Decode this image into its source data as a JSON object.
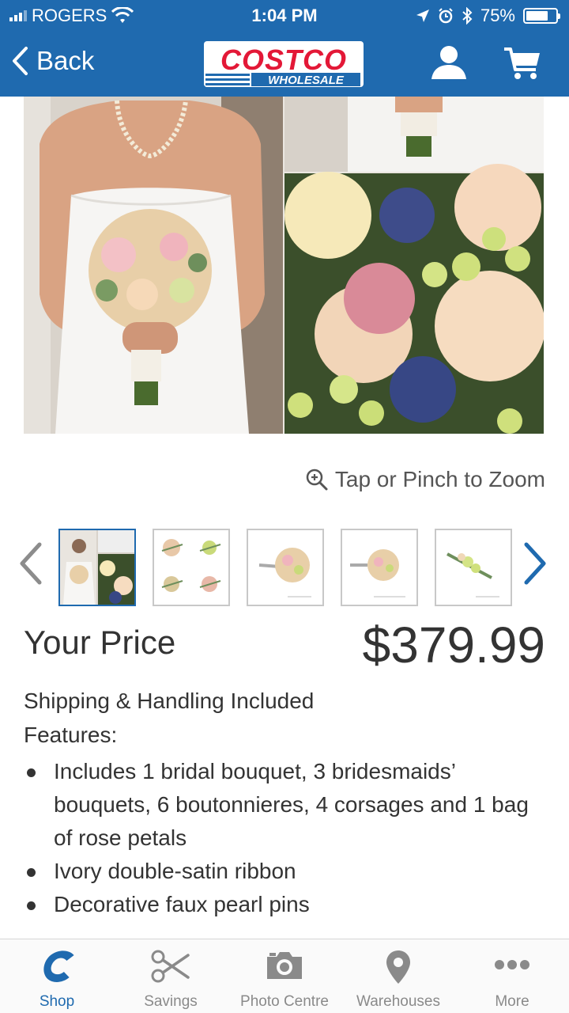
{
  "status_bar": {
    "carrier": "ROGERS",
    "time": "1:04 PM",
    "battery": "75%",
    "battery_level": 0.75
  },
  "header": {
    "back_label": "Back",
    "logo_text": "COSTCO",
    "logo_subtext": "WHOLESALE",
    "brand_red": "#e31837",
    "brand_blue": "#1f6aaf"
  },
  "gallery": {
    "zoom_hint": "Tap or Pinch to Zoom",
    "thumbnail_count": 5,
    "selected_index": 0
  },
  "product": {
    "price_label": "Your Price",
    "price": "$379.99",
    "shipping": "Shipping & Handling Included",
    "features_label": "Features:",
    "features": [
      "Includes 1 bridal bouquet, 3 bridesmaids’ bouquets, 6 boutonnieres, 4 corsages and 1 bag of rose petals",
      "Ivory double-satin ribbon",
      "Decorative faux pearl pins"
    ]
  },
  "tabs": [
    {
      "label": "Shop",
      "icon": "costco-c-icon",
      "active": true
    },
    {
      "label": "Savings",
      "icon": "scissors-icon",
      "active": false
    },
    {
      "label": "Photo Centre",
      "icon": "camera-icon",
      "active": false
    },
    {
      "label": "Warehouses",
      "icon": "map-pin-icon",
      "active": false
    },
    {
      "label": "More",
      "icon": "more-dots-icon",
      "active": false
    }
  ]
}
